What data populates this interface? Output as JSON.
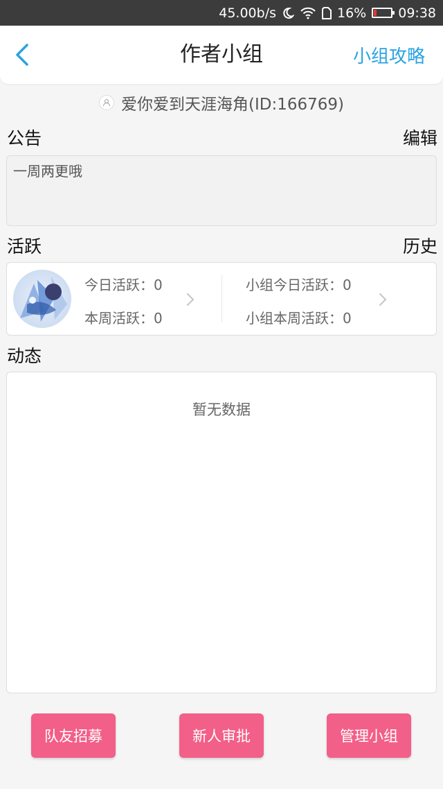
{
  "status_bar": {
    "speed": "45.00b/s",
    "battery": "16%",
    "time": "09:38",
    "icons": [
      "moon-icon",
      "wifi-icon",
      "sim-icon",
      "battery-icon"
    ]
  },
  "nav": {
    "title": "作者小组",
    "right_link": "小组攻略",
    "accent_color": "#2aa3e0"
  },
  "owner": {
    "name": "爱你爱到天涯海角(ID:166769)"
  },
  "notice": {
    "header": "公告",
    "action": "编辑",
    "content": "一周两更哦"
  },
  "activity": {
    "header": "活跃",
    "action": "历史",
    "personal": {
      "today": "今日活跃：0",
      "week": "本周活跃：0"
    },
    "group": {
      "today": "小组今日活跃：0",
      "week": "小组本周活跃：0"
    }
  },
  "feed": {
    "header": "动态",
    "empty": "暂无数据"
  },
  "buttons": {
    "recruit": "队友招募",
    "approve": "新人审批",
    "manage": "管理小组",
    "color": "#f25f88"
  }
}
